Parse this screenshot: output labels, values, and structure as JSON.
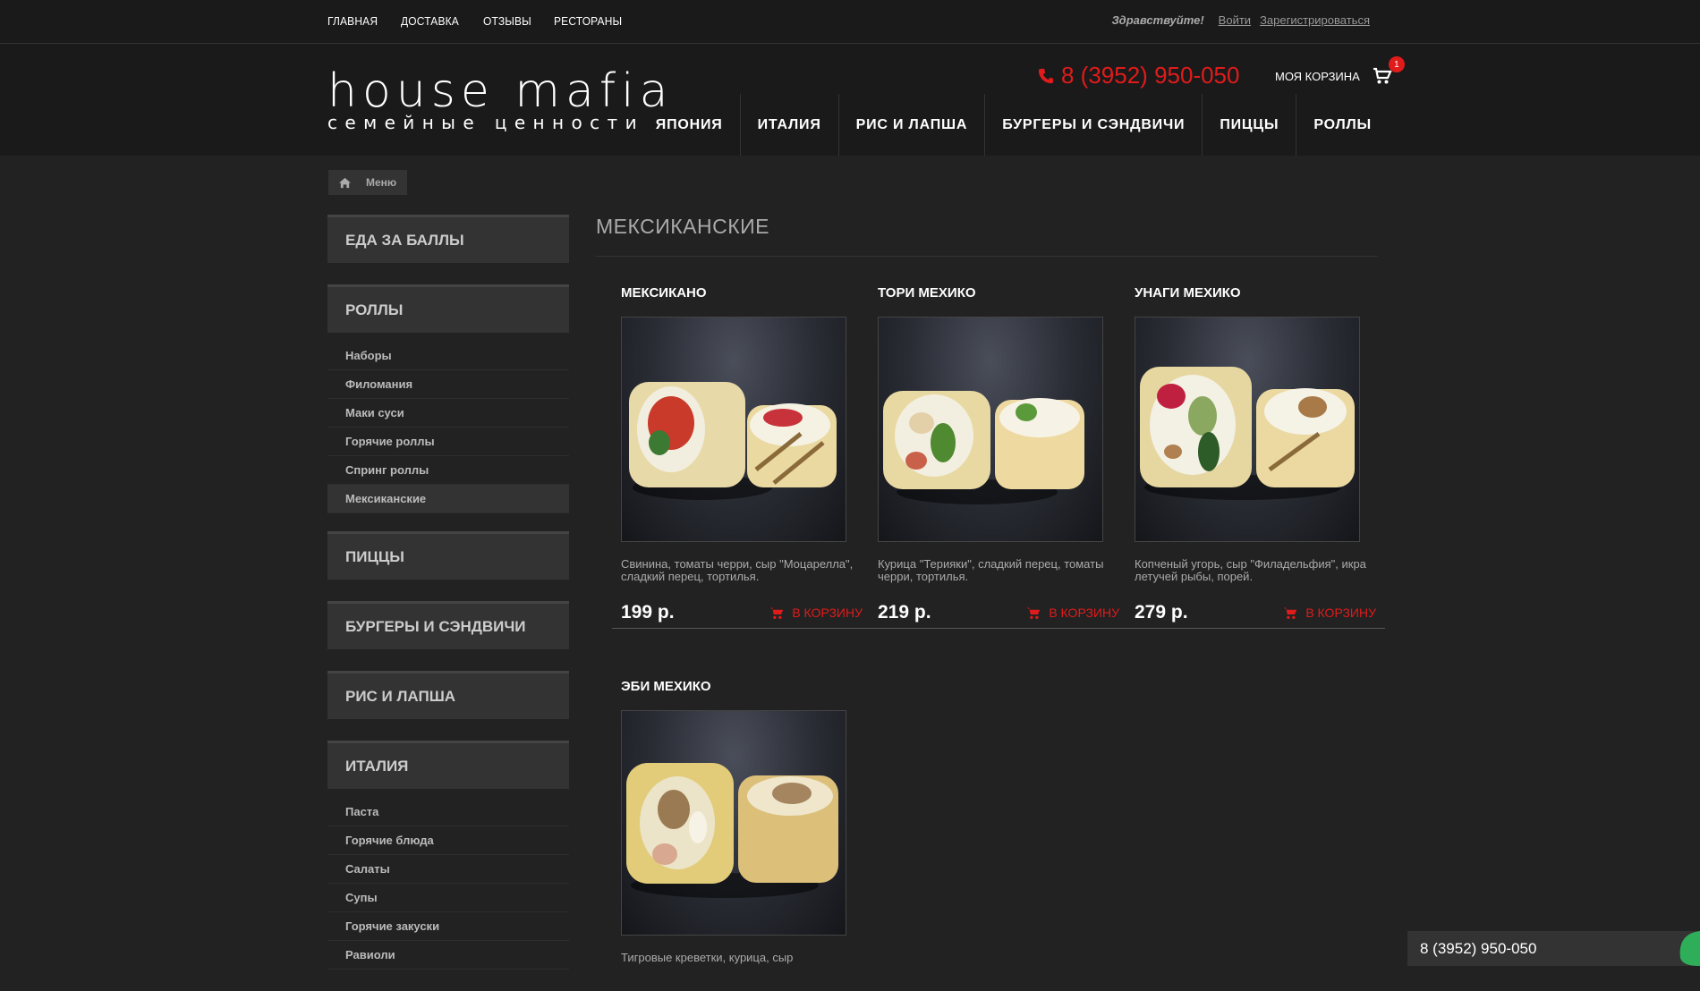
{
  "topnav": [
    "ГЛАВНАЯ",
    "ДОСТАВКА",
    "ОТЗЫВЫ",
    "РЕСТОРАНЫ"
  ],
  "auth": {
    "greeting": "Здравствуйте!",
    "login": "Войти",
    "register": "Зарегистрироваться"
  },
  "logo": {
    "line1": "house mafia",
    "line2": "семейные ценности"
  },
  "phone": "8 (3952) 950-050",
  "cart": {
    "label": "МОЯ КОРЗИНА",
    "count": "1"
  },
  "mainnav": [
    "ЯПОНИЯ",
    "ИТАЛИЯ",
    "РИС И ЛАПША",
    "БУРГЕРЫ И СЭНДВИЧИ",
    "ПИЦЦЫ",
    "РОЛЛЫ"
  ],
  "breadcrumb": "Меню",
  "sidebar": {
    "cat1": "ЕДА ЗА БАЛЛЫ",
    "cat2": "РОЛЛЫ",
    "rolls": [
      "Наборы",
      "Филомания",
      "Маки суси",
      "Горячие роллы",
      "Спринг роллы",
      "Мексиканские"
    ],
    "cat3": "ПИЦЦЫ",
    "cat4": "БУРГЕРЫ И СЭНДВИЧИ",
    "cat5": "РИС И ЛАПША",
    "cat6": "ИТАЛИЯ",
    "italy": [
      "Паста",
      "Горячие блюда",
      "Салаты",
      "Супы",
      "Горячие закуски",
      "Равиоли"
    ]
  },
  "page_title": "МЕКСИКАНСКИЕ",
  "products": [
    {
      "name": "МЕКСИКАНО",
      "desc": "Свинина, томаты черри, сыр \"Моцарелла\", сладкий перец, тортилья.",
      "price": "199 р.",
      "buy": "В КОРЗИНУ"
    },
    {
      "name": "ТОРИ МЕХИКО",
      "desc": "Курица \"Терияки\", сладкий перец, томаты черри, тортилья.",
      "price": "219 р.",
      "buy": "В КОРЗИНУ"
    },
    {
      "name": "УНАГИ МЕХИКО",
      "desc": "Копченый угорь, сыр \"Филадельфия\", икра летучей рыбы, порей.",
      "price": "279 р.",
      "buy": "В КОРЗИНУ"
    },
    {
      "name": "ЭБИ МЕХИКО",
      "desc": "Тигровые креветки, курица, сыр",
      "price": "",
      "buy": ""
    }
  ],
  "footer_phone": "8 (3952) 950-050",
  "colors": {
    "accent": "#e01b1b",
    "bg": "#222222",
    "panel": "#333333"
  }
}
